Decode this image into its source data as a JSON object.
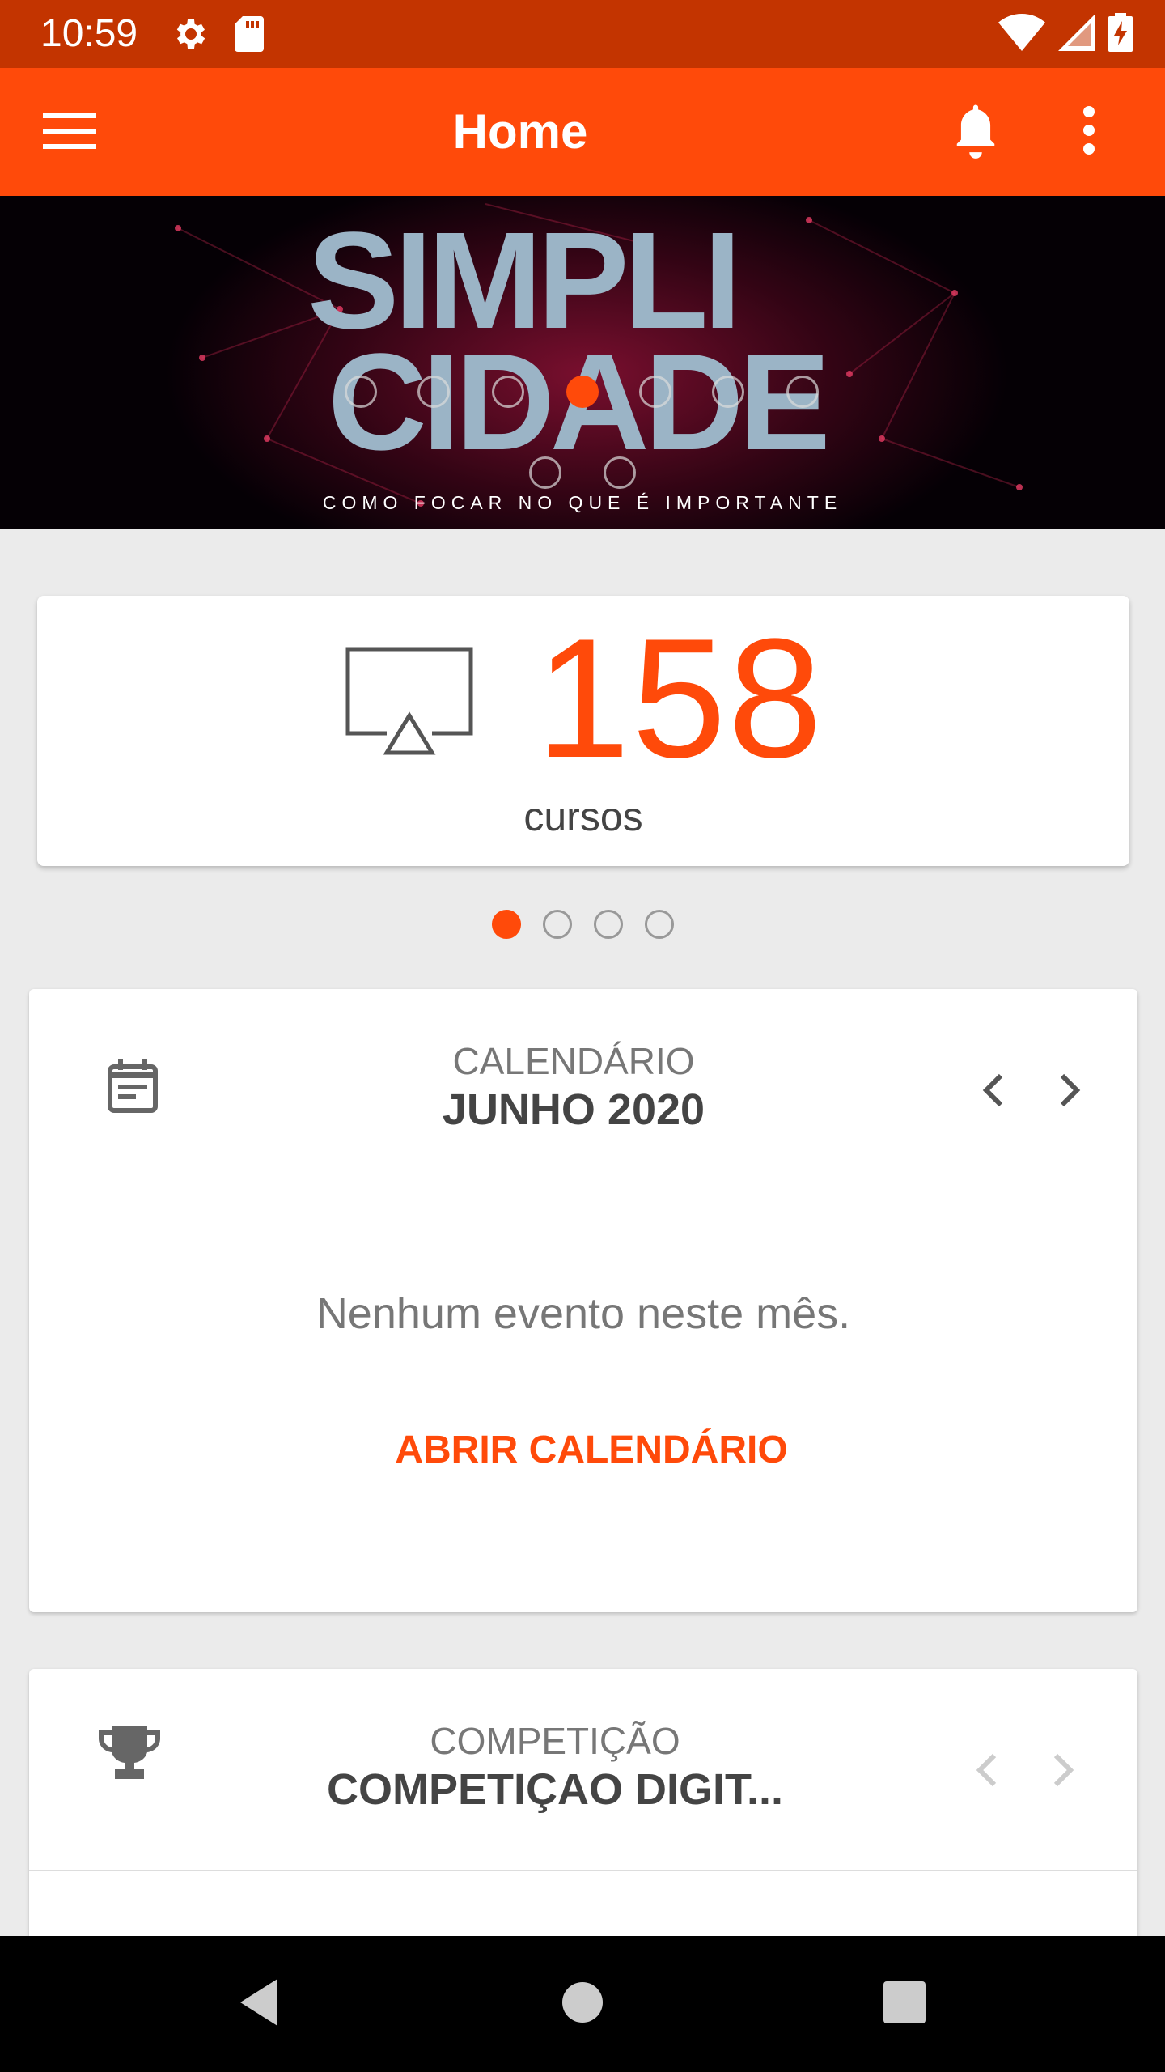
{
  "status_bar": {
    "time": "10:59",
    "icons": [
      "gear-icon",
      "sd-card-icon",
      "wifi-icon",
      "signal-icon",
      "battery-charging-icon"
    ]
  },
  "app_bar": {
    "title": "Home",
    "menu_icon": "hamburger-menu-icon",
    "notification_icon": "bell-icon",
    "more_icon": "more-vertical-icon",
    "background_color": "#ff4a0a"
  },
  "banner": {
    "line1": "SIMPLI",
    "line2": "CIDADE",
    "subtitle": "COMO FOCAR NO QUE É IMPORTANTE",
    "slide_count": 9,
    "active_slide": 3
  },
  "courses": {
    "count": "158",
    "label": "cursos",
    "icon": "airplay-tv-icon"
  },
  "pager": {
    "pages": 4,
    "active_page": 0
  },
  "calendar": {
    "caption": "CALENDÁRIO",
    "month": "JUNHO 2020",
    "empty_message": "Nenhum evento neste mês.",
    "open_button": "ABRIR CALENDÁRIO",
    "icon": "calendar-event-icon"
  },
  "competition": {
    "caption": "COMPETIÇÃO",
    "title": "COMPETIÇAO DIGIT...",
    "icon": "trophy-icon"
  },
  "nav_bar": {
    "icons": [
      "back-triangle-icon",
      "home-circle-icon",
      "recents-square-icon"
    ]
  },
  "colors": {
    "accent": "#ff4a0a",
    "status_bar": "#c33400",
    "background": "#ebebeb"
  }
}
